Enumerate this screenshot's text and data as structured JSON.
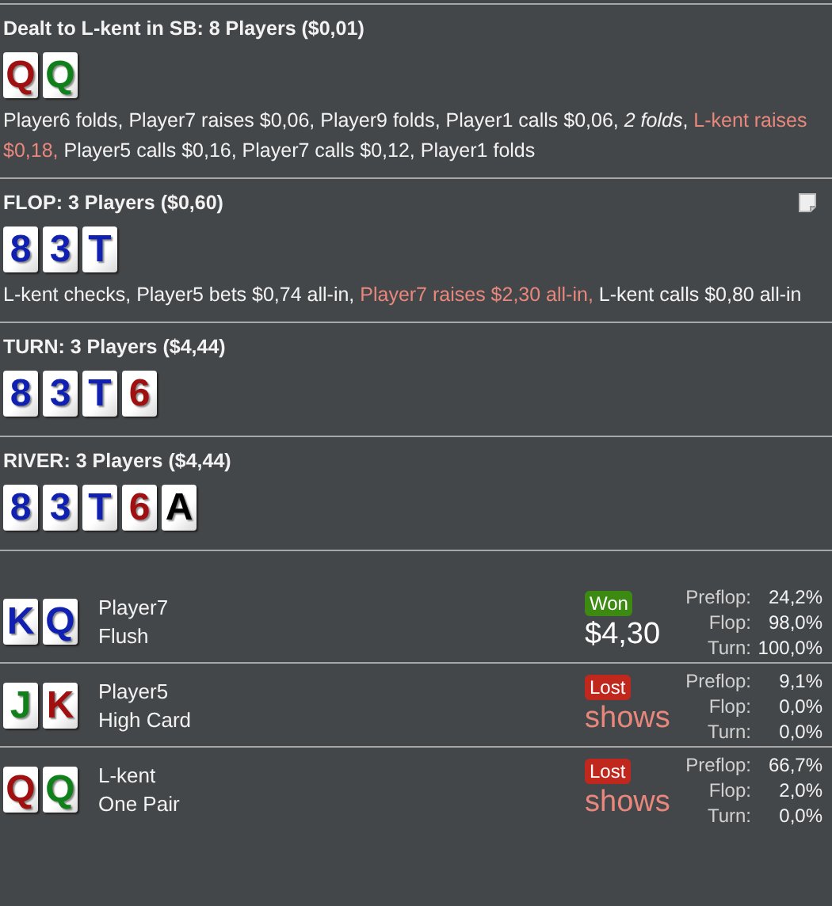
{
  "streets": [
    {
      "title": "Dealt to L-kent in SB: 8 Players ($0,01)",
      "note": false,
      "cards": [
        {
          "rank": "Q",
          "color": "#a01010"
        },
        {
          "rank": "Q",
          "color": "#10801a"
        }
      ],
      "actions": [
        {
          "text": "Player6 folds, Player7 raises $0,06, Player9 folds, Player1 calls $0,06, ",
          "kind": "normal"
        },
        {
          "text": "2 folds",
          "kind": "folded"
        },
        {
          "text": ", ",
          "kind": "normal"
        },
        {
          "text": "L-kent raises $0,18,",
          "kind": "hero"
        },
        {
          "text": " Player5 calls $0,16, Player7 calls $0,12, Player1 folds",
          "kind": "normal"
        }
      ]
    },
    {
      "title": "FLOP: 3 Players ($0,60)",
      "note": true,
      "cards": [
        {
          "rank": "8",
          "color": "#1020b0"
        },
        {
          "rank": "3",
          "color": "#1020b0"
        },
        {
          "rank": "T",
          "color": "#1020b0"
        }
      ],
      "actions": [
        {
          "text": "L-kent checks, Player5 bets $0,74 all-in, ",
          "kind": "normal"
        },
        {
          "text": "Player7 raises $2,30 all-in,",
          "kind": "hero"
        },
        {
          "text": " L-kent calls $0,80 all-in",
          "kind": "normal"
        }
      ]
    },
    {
      "title": "TURN: 3 Players ($4,44)",
      "note": false,
      "cards": [
        {
          "rank": "8",
          "color": "#1020b0"
        },
        {
          "rank": "3",
          "color": "#1020b0"
        },
        {
          "rank": "T",
          "color": "#1020b0"
        },
        {
          "rank": "6",
          "color": "#a01010"
        }
      ]
    },
    {
      "title": "RIVER: 3 Players ($4,44)",
      "note": false,
      "cards": [
        {
          "rank": "8",
          "color": "#1020b0"
        },
        {
          "rank": "3",
          "color": "#1020b0"
        },
        {
          "rank": "T",
          "color": "#1020b0"
        },
        {
          "rank": "6",
          "color": "#a01010"
        },
        {
          "rank": "A",
          "color": "#000000"
        }
      ]
    }
  ],
  "results": [
    {
      "cards": [
        {
          "rank": "K",
          "color": "#1020b0"
        },
        {
          "rank": "Q",
          "color": "#1020b0"
        }
      ],
      "player": "Player7",
      "hand": "Flush",
      "won": true,
      "badge": "Won",
      "amount": "$4,30",
      "equity": [
        {
          "label": "Preflop:",
          "value": "24,2%"
        },
        {
          "label": "Flop:",
          "value": "98,0%"
        },
        {
          "label": "Turn:",
          "value": "100,0%"
        }
      ]
    },
    {
      "cards": [
        {
          "rank": "J",
          "color": "#10801a"
        },
        {
          "rank": "K",
          "color": "#a01010"
        }
      ],
      "player": "Player5",
      "hand": "High Card",
      "won": false,
      "badge": "Lost",
      "amount": "shows",
      "equity": [
        {
          "label": "Preflop:",
          "value": "9,1%"
        },
        {
          "label": "Flop:",
          "value": "0,0%"
        },
        {
          "label": "Turn:",
          "value": "0,0%"
        }
      ]
    },
    {
      "cards": [
        {
          "rank": "Q",
          "color": "#a01010"
        },
        {
          "rank": "Q",
          "color": "#10801a"
        }
      ],
      "player": "L-kent",
      "hand": "One Pair",
      "won": false,
      "badge": "Lost",
      "amount": "shows",
      "equity": [
        {
          "label": "Preflop:",
          "value": "66,7%"
        },
        {
          "label": "Flop:",
          "value": "2,0%"
        },
        {
          "label": "Turn:",
          "value": "0,0%"
        }
      ]
    }
  ]
}
